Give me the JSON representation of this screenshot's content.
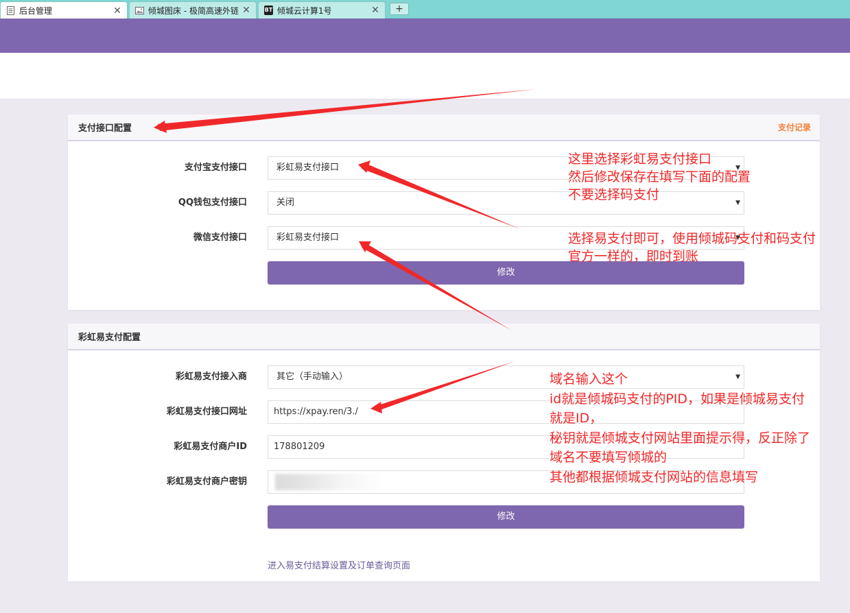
{
  "tabs": [
    {
      "title": "后台管理",
      "icon": "document-icon",
      "close": "✕"
    },
    {
      "title": "倾城图床 - 极简高速外链",
      "icon": "image-icon",
      "close": "✕"
    },
    {
      "title": "倾城云计算1号",
      "icon": "bt-icon",
      "badge": "BT",
      "close": "✕"
    }
  ],
  "new_tab_label": "+",
  "panel1": {
    "title": "支付接口配置",
    "link": "支付记录",
    "rows": [
      {
        "label": "支付宝支付接口",
        "value": "彩虹易支付接口"
      },
      {
        "label": "QQ钱包支付接口",
        "value": "关闭"
      },
      {
        "label": "微信支付接口",
        "value": "彩虹易支付接口"
      }
    ],
    "submit": "修改"
  },
  "panel2": {
    "title": "彩虹易支付配置",
    "rows": [
      {
        "label": "彩虹易支付接入商",
        "value": "其它（手动输入）"
      },
      {
        "label": "彩虹易支付接口网址",
        "value": "https://xpay.ren/3./"
      },
      {
        "label": "彩虹易支付商户ID",
        "value": "178801209"
      },
      {
        "label": "彩虹易支付商户密钥",
        "value": ""
      }
    ],
    "submit": "修改",
    "footer_link": "进入易支付结算设置及订单查询页面"
  },
  "annotations": {
    "note1": [
      "这里选择彩虹易支付接口",
      "然后修改保存在填写下面的配置",
      "不要选择码支付"
    ],
    "note2": [
      "选择易支付即可，使用倾城码支付和码支付",
      "官方一样的，即时到账"
    ],
    "note3": [
      "域名输入这个",
      "id就是倾城码支付的PID，如果是倾城易支付",
      "就是ID，",
      "秘钥就是倾城支付网站里面提示得，反正除了",
      "域名不要填写倾城的",
      "其他都根据倾城支付网站的信息填写"
    ]
  },
  "colors": {
    "tab_bar": "#7fd6d2",
    "header": "#7e67ae",
    "button": "#7e67ae",
    "link_orange": "#f57c33",
    "annotation_red": "#f0282a"
  }
}
